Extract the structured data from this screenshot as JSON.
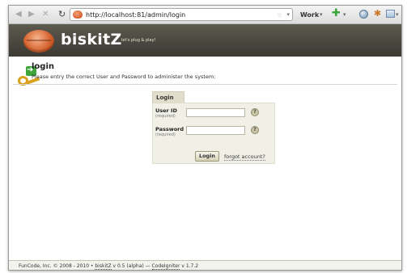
{
  "browser": {
    "back_glyph": "◀",
    "forward_glyph": "▶",
    "stop_glyph": "✕",
    "reload_glyph": "↻",
    "url": "http://localhost:81/admin/login",
    "bookmark_star": "☆",
    "url_dropdown": "▾",
    "profile_label": "Work",
    "profile_dropdown": "▾",
    "addon_glyph": "✚",
    "addon_dropdown": "▾",
    "tool_glyph": "✱",
    "menu_dropdown": "▾",
    "icons": [
      "back-icon",
      "forward-icon",
      "stop-icon",
      "reload-icon",
      "site-favicon",
      "bookmark-star-icon",
      "plus-icon",
      "globe-icon",
      "tools-icon",
      "menu-icon"
    ]
  },
  "header": {
    "title": "biskitZ",
    "tagline": "let's plug & play!",
    "logo_icon": "piggy-bank-logo"
  },
  "page": {
    "title": "login",
    "description": "Please entry the correct User and Password to administer the system:",
    "icon": "key-login-icon"
  },
  "login_form": {
    "tab_label": "Login",
    "user_label": "User ID",
    "user_hint": "(required)",
    "user_value": "",
    "password_label": "Password",
    "password_hint": "(required)",
    "password_value": "",
    "help_glyph": "?",
    "submit_label": "Login",
    "forgot_label": "forgot account?"
  },
  "footer": {
    "prefix": "FunCode, Inc. © 2008 - 2010 • ",
    "app_link": "biskitZ",
    "middle": " v 0.5 (alpha) — ",
    "framework_link": "CodeIgniter",
    "suffix": " v 1.7.2"
  },
  "colors": {
    "header_bg": "#4a4840",
    "accent_orange": "#d4612d",
    "form_bg": "#f1f0e7",
    "tab_bg": "#e0ddcc"
  }
}
